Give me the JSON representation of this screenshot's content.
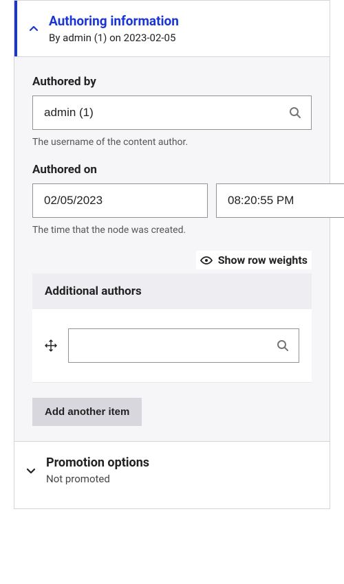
{
  "authoring": {
    "title": "Authoring information",
    "subtitle": "By admin (1) on 2023-02-05",
    "authored_by": {
      "label": "Authored by",
      "value": "admin (1)",
      "help": "The username of the content author."
    },
    "authored_on": {
      "label": "Authored on",
      "date": "02/05/2023",
      "time": "08:20:55 PM",
      "help": "The time that the node was created."
    },
    "show_row_weights": "Show row weights",
    "additional_authors": {
      "label": "Additional authors",
      "item_value": ""
    },
    "add_another": "Add another item"
  },
  "promotion": {
    "title": "Promotion options",
    "subtitle": "Not promoted"
  }
}
